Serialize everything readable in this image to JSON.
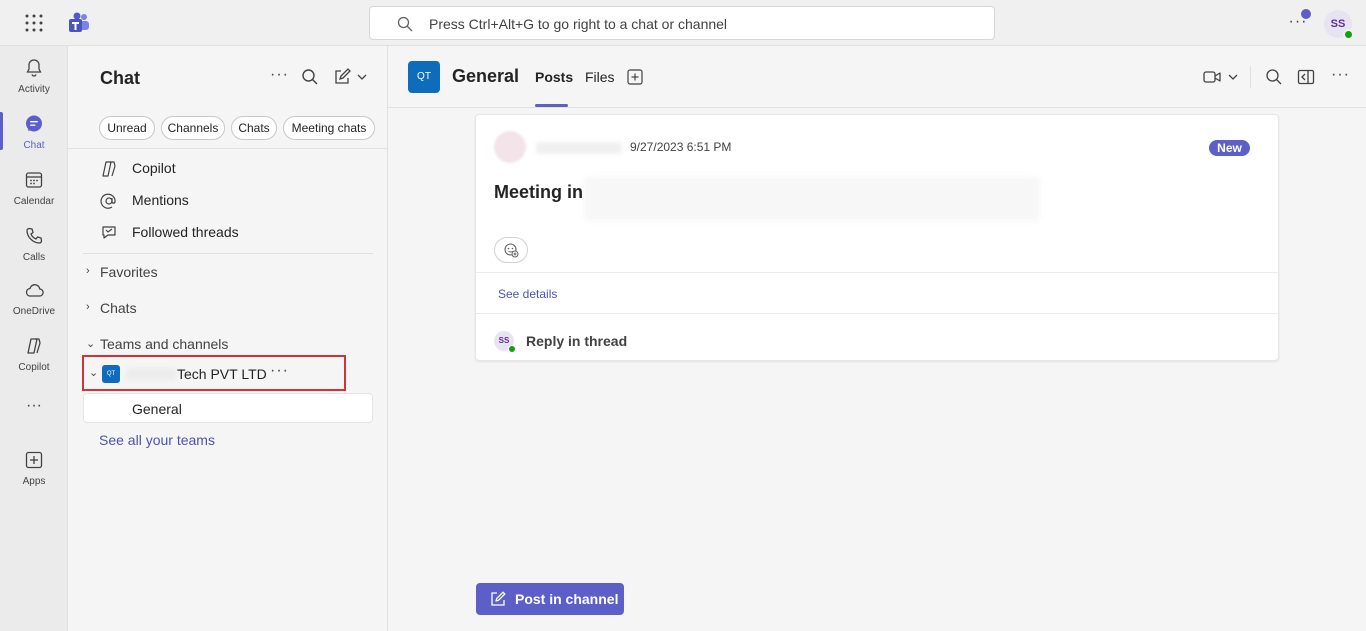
{
  "topbar": {
    "search_placeholder": "Press Ctrl+Alt+G to go right to a chat or channel",
    "more_label": "···",
    "avatar_initials": "SS"
  },
  "rail": {
    "items": [
      {
        "label": "Activity",
        "icon": "bell-icon"
      },
      {
        "label": "Chat",
        "icon": "chat-icon"
      },
      {
        "label": "Calendar",
        "icon": "calendar-icon"
      },
      {
        "label": "Calls",
        "icon": "phone-icon"
      },
      {
        "label": "OneDrive",
        "icon": "cloud-icon"
      },
      {
        "label": "Copilot",
        "icon": "copilot-icon"
      },
      {
        "label": "Apps",
        "icon": "plus-square-icon"
      }
    ],
    "more_label": "···"
  },
  "panel": {
    "title": "Chat",
    "more_label": "···",
    "filters": [
      "Unread",
      "Channels",
      "Chats",
      "Meeting chats"
    ],
    "quick_items": [
      {
        "label": "Copilot",
        "icon": "copilot-icon"
      },
      {
        "label": "Mentions",
        "icon": "at-icon"
      },
      {
        "label": "Followed threads",
        "icon": "thread-icon"
      }
    ],
    "sections": {
      "favorites": "Favorites",
      "chats": "Chats",
      "teams": "Teams and channels"
    },
    "team": {
      "badge": "QT",
      "name": "Tech PVT LTD",
      "more_label": "···"
    },
    "channel": "General",
    "see_all": "See all your teams"
  },
  "main": {
    "badge": "QT",
    "title": "General",
    "tabs": [
      "Posts",
      "Files"
    ],
    "active_tab": "Posts",
    "more_label": "···"
  },
  "post": {
    "timestamp": "9/27/2023 6:51 PM",
    "new_badge": "New",
    "body": "Meeting in",
    "see_details": "See details",
    "reply_avatar": "SS",
    "reply_label": "Reply in thread"
  },
  "compose": {
    "post_button": "Post in channel"
  },
  "colors": {
    "accent": "#5b5fc7",
    "team_badge": "#0f6cbd",
    "highlight_border": "#d13438",
    "presence": "#13a10e"
  }
}
